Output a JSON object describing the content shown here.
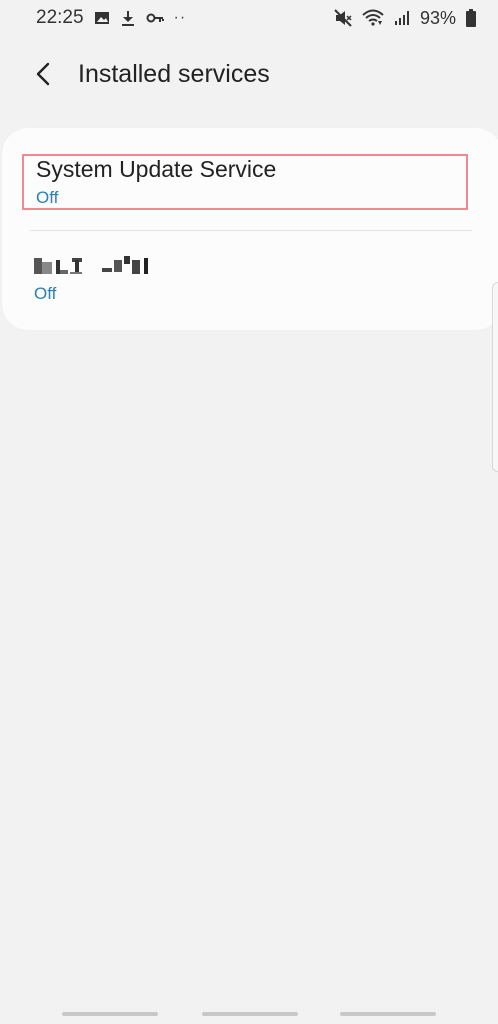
{
  "status_bar": {
    "time": "22:25",
    "battery": "93%",
    "icons": [
      "image-icon",
      "download-icon",
      "key-icon",
      "more-dots-icon",
      "mute-icon",
      "wifi-icon",
      "signal-icon",
      "battery-icon"
    ],
    "dots": "··"
  },
  "header": {
    "title": "Installed services"
  },
  "services": [
    {
      "name": "System Update Service",
      "status": "Off"
    },
    {
      "name": "",
      "status": "Off"
    }
  ],
  "colors": {
    "background": "#f2f2f2",
    "card": "#fcfcfc",
    "status_text": "#2a7fb6",
    "highlight_border": "#f08a90"
  }
}
